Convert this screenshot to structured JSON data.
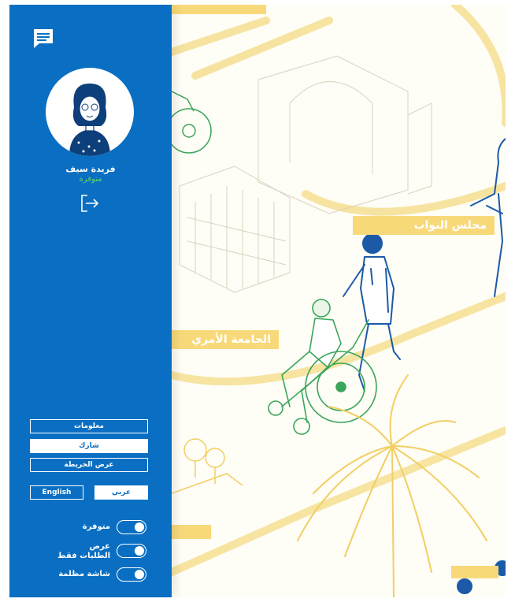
{
  "map": {
    "labels": {
      "parliament": "مجلس النواب",
      "university": "الجامعة الأمري"
    }
  },
  "sidebar": {
    "chat_icon": "chat-bubble-icon",
    "user": {
      "name": "فريدة سيف",
      "status": "متوفرة",
      "status_color": "#61d36b"
    },
    "logout_icon": "logout-icon",
    "nav": {
      "info": "معلومات",
      "share": "شارك",
      "map_view": "عرض الخريطة",
      "active": "share"
    },
    "language": {
      "arabic": "عربي",
      "english": "English",
      "active": "arabic"
    },
    "toggles": [
      {
        "label": "متوفرة",
        "on": true
      },
      {
        "label": "عرض\nالطلبات فقط",
        "on": true
      },
      {
        "label": "شاشة مظلمة",
        "on": true
      }
    ]
  },
  "colors": {
    "sidebar": "#0a6fc2",
    "map_accent": "#f8d97a",
    "figure_stroke": "#1c5aa8",
    "green_stroke": "#3aa55a"
  }
}
